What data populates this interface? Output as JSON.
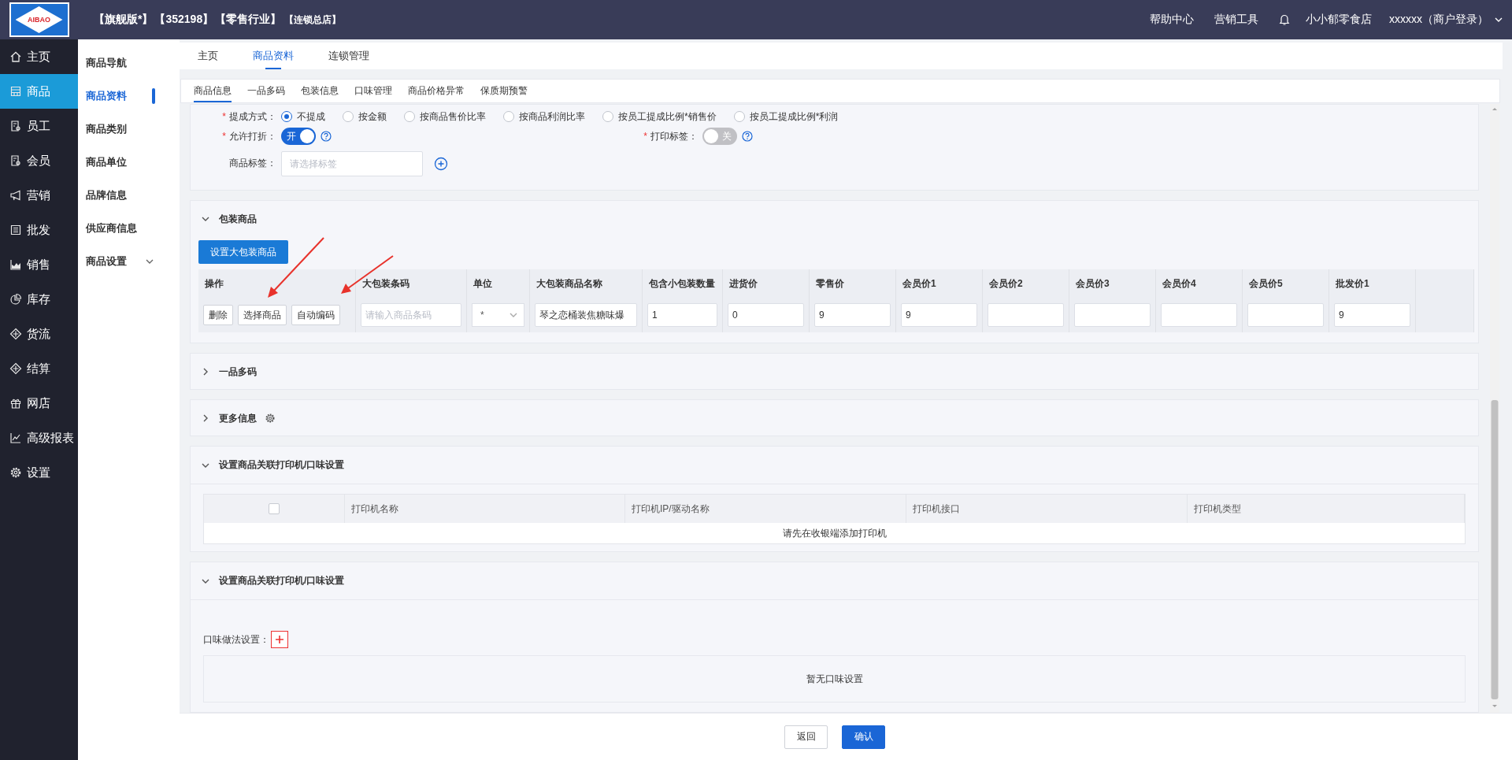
{
  "header": {
    "logo": "AIBAO",
    "badges": [
      {
        "text": "【旗舰版*】",
        "kind": "main"
      },
      {
        "text": "【352198】",
        "kind": "main"
      },
      {
        "text": "【零售行业】",
        "kind": "main"
      },
      {
        "text": "【连锁总店】",
        "kind": "sub"
      }
    ],
    "links": [
      "帮助中心",
      "营销工具"
    ],
    "store": "小小郁零食店",
    "account": "xxxxxx（商户登录）"
  },
  "nav": [
    {
      "label": "主页",
      "selected": false
    },
    {
      "label": "商品",
      "selected": true
    },
    {
      "label": "员工",
      "selected": false
    },
    {
      "label": "会员",
      "selected": false
    },
    {
      "label": "营销",
      "selected": false
    },
    {
      "label": "批发",
      "selected": false
    },
    {
      "label": "销售",
      "selected": false
    },
    {
      "label": "库存",
      "selected": false
    },
    {
      "label": "货流",
      "selected": false
    },
    {
      "label": "结算",
      "selected": false
    },
    {
      "label": "网店",
      "selected": false
    },
    {
      "label": "高级报表",
      "selected": false
    },
    {
      "label": "设置",
      "selected": false
    }
  ],
  "subnav": [
    {
      "label": "商品导航",
      "selected": false,
      "kind": "link"
    },
    {
      "label": "商品资料",
      "selected": true,
      "kind": "link"
    },
    {
      "label": "商品类别",
      "selected": false,
      "kind": "link"
    },
    {
      "label": "商品单位",
      "selected": false,
      "kind": "link"
    },
    {
      "label": "品牌信息",
      "selected": false,
      "kind": "link"
    },
    {
      "label": "供应商信息",
      "selected": false,
      "kind": "link"
    },
    {
      "label": "商品设置",
      "selected": false,
      "kind": "group"
    }
  ],
  "tabs": [
    {
      "label": "主页",
      "selected": false
    },
    {
      "label": "商品资料",
      "selected": true
    },
    {
      "label": "连锁管理",
      "selected": false
    }
  ],
  "subtabs": [
    {
      "label": "商品信息",
      "selected": true
    },
    {
      "label": "一品多码",
      "selected": false
    },
    {
      "label": "包装信息",
      "selected": false
    },
    {
      "label": "口味管理",
      "selected": false
    },
    {
      "label": "商品价格异常",
      "selected": false
    },
    {
      "label": "保质期预警",
      "selected": false
    }
  ],
  "form": {
    "commission": {
      "label": "提成方式：",
      "required": true,
      "options": [
        {
          "label": "不提成",
          "selected": true
        },
        {
          "label": "按金额",
          "selected": false
        },
        {
          "label": "按商品售价比率",
          "selected": false
        },
        {
          "label": "按商品利润比率",
          "selected": false
        },
        {
          "label": "按员工提成比例*销售价",
          "selected": false
        },
        {
          "label": "按员工提成比例*利润",
          "selected": false
        }
      ]
    },
    "discount": {
      "label": "允许打折：",
      "required": true,
      "on": true,
      "text": "开"
    },
    "print_label": {
      "label": "打印标签：",
      "required": true,
      "on": false,
      "text": "关"
    },
    "tags": {
      "label": "商品标签：",
      "required": false,
      "placeholder": "请选择标签"
    }
  },
  "package": {
    "title": "包装商品",
    "expanded": true,
    "button": "设置大包装商品",
    "columns": [
      "操作",
      "大包装条码",
      "单位",
      "大包装商品名称",
      "包含小包装数量",
      "进货价",
      "零售价",
      "会员价1",
      "会员价2",
      "会员价3",
      "会员价4",
      "会员价5",
      "批发价1"
    ],
    "actions": [
      "删除",
      "选择商品",
      "自动编码"
    ],
    "fields": [
      {
        "kind": "input",
        "placeholder": "请输入商品条码"
      },
      {
        "kind": "select",
        "value": "*"
      },
      {
        "kind": "input",
        "value": "琴之恋桶装焦糖味爆"
      },
      {
        "kind": "input",
        "value": "1"
      },
      {
        "kind": "input",
        "value": "0"
      },
      {
        "kind": "input",
        "value": "9"
      },
      {
        "kind": "input",
        "value": "9"
      },
      {
        "kind": "input"
      },
      {
        "kind": "input"
      },
      {
        "kind": "input"
      },
      {
        "kind": "input"
      },
      {
        "kind": "input",
        "value": "9"
      }
    ]
  },
  "sections": [
    {
      "title": "一品多码",
      "expanded": false,
      "kind": "plain"
    },
    {
      "title": "更多信息",
      "expanded": false,
      "kind": "settings"
    }
  ],
  "printers": {
    "title": "设置商品关联打印机/口味设置",
    "expanded": true,
    "checked": false,
    "columns": [
      "打印机名称",
      "打印机IP/驱动名称",
      "打印机接口",
      "打印机类型"
    ],
    "empty": "请先在收银端添加打印机"
  },
  "flavors": {
    "title": "设置商品关联打印机/口味设置",
    "expanded": true,
    "label": "口味做法设置：",
    "empty": "暂无口味设置"
  },
  "footer": {
    "buttons": [
      {
        "label": "返回",
        "kind": "secondary"
      },
      {
        "label": "确认",
        "kind": "primary"
      }
    ]
  }
}
